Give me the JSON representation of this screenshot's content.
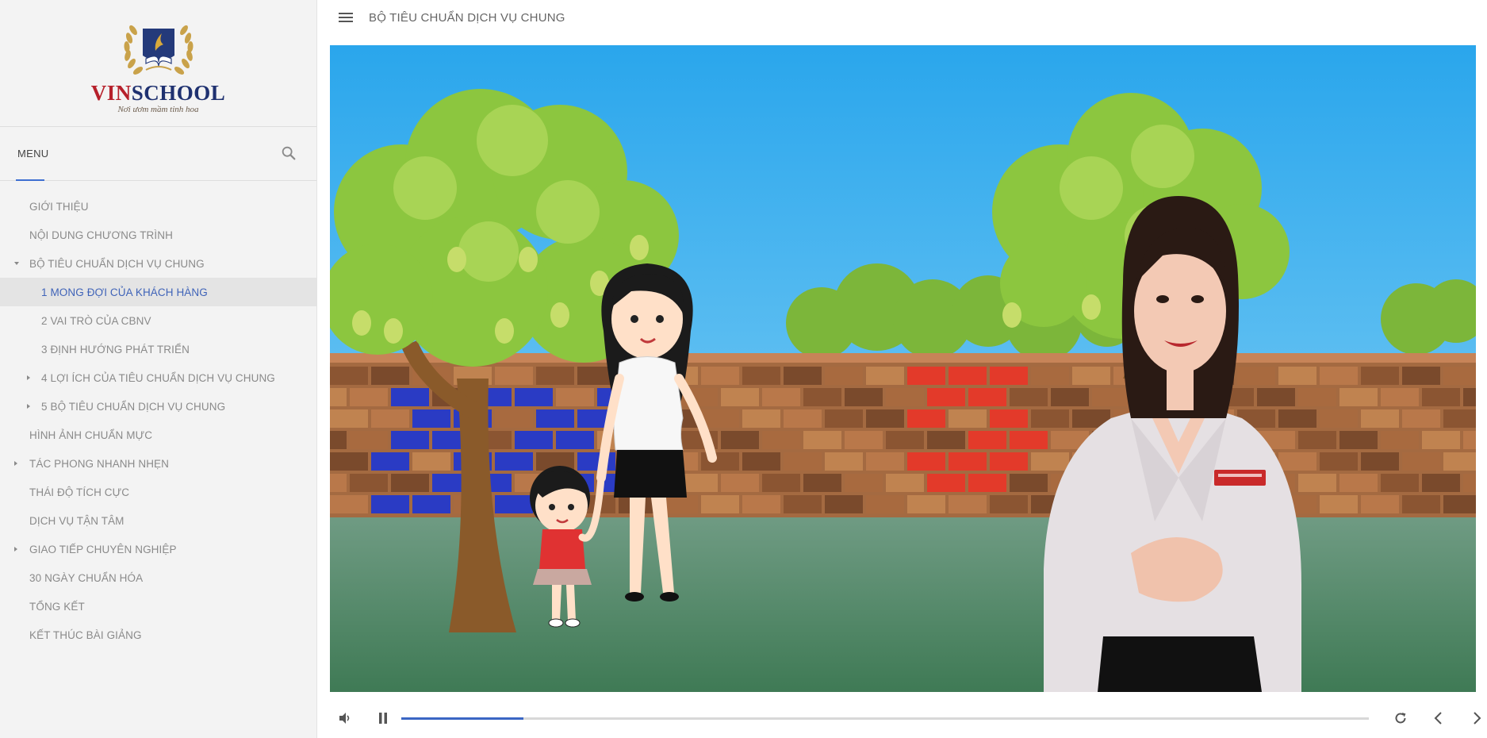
{
  "brand": {
    "name_part1": "VIN",
    "name_part2": "SCHOOL",
    "tagline": "Nơi ươm mầm tinh hoa"
  },
  "menu": {
    "title": "MENU",
    "search_icon": "search-icon"
  },
  "nav": [
    {
      "label": "GIỚI THIỆU",
      "level": 0,
      "caret": "none",
      "active": false
    },
    {
      "label": "NỘI DUNG CHƯƠNG TRÌNH",
      "level": 0,
      "caret": "none",
      "active": false
    },
    {
      "label": "BỘ TIÊU CHUẨN DỊCH VỤ CHUNG",
      "level": 0,
      "caret": "down",
      "active": false
    },
    {
      "label": "1 MONG ĐỢI CỦA KHÁCH HÀNG",
      "level": 1,
      "caret": "none",
      "active": true
    },
    {
      "label": "2 VAI TRÒ CỦA CBNV",
      "level": 1,
      "caret": "none",
      "active": false
    },
    {
      "label": "3 ĐỊNH HƯỚNG PHÁT TRIỂN",
      "level": 1,
      "caret": "none",
      "active": false
    },
    {
      "label": "4 LỢI ÍCH CỦA TIÊU CHUẨN DỊCH VỤ CHUNG",
      "level": 1,
      "caret": "right",
      "active": false
    },
    {
      "label": "5 BỘ TIÊU CHUẨN DỊCH VỤ CHUNG",
      "level": 1,
      "caret": "right",
      "active": false
    },
    {
      "label": "HÌNH ẢNH CHUẨN MỰC",
      "level": 0,
      "caret": "none",
      "active": false
    },
    {
      "label": "TÁC PHONG NHANH NHẸN",
      "level": 0,
      "caret": "right",
      "active": false
    },
    {
      "label": "THÁI ĐỘ TÍCH CỰC",
      "level": 0,
      "caret": "none",
      "active": false
    },
    {
      "label": "DỊCH VỤ TẬN TÂM",
      "level": 0,
      "caret": "none",
      "active": false
    },
    {
      "label": "GIAO TIẾP CHUYÊN NGHIỆP",
      "level": 0,
      "caret": "right",
      "active": false
    },
    {
      "label": "30 NGÀY CHUẨN HÓA",
      "level": 0,
      "caret": "none",
      "active": false
    },
    {
      "label": "TỔNG KẾT",
      "level": 0,
      "caret": "none",
      "active": false
    },
    {
      "label": "KẾT THÚC BÀI GIẢNG",
      "level": 0,
      "caret": "none",
      "active": false
    }
  ],
  "header": {
    "title": "BỘ TIÊU CHUẨN DỊCH VỤ CHUNG",
    "menu_icon": "hamburger-icon"
  },
  "player": {
    "progress": 0.126,
    "state": "playing",
    "icons": [
      "volume-icon",
      "pause-icon",
      "replay-icon",
      "previous-icon",
      "next-icon"
    ]
  },
  "colors": {
    "accent": "#3b66c4",
    "active_text": "#3f63b8",
    "brand_red": "#b6202b",
    "brand_navy": "#1f3170"
  }
}
